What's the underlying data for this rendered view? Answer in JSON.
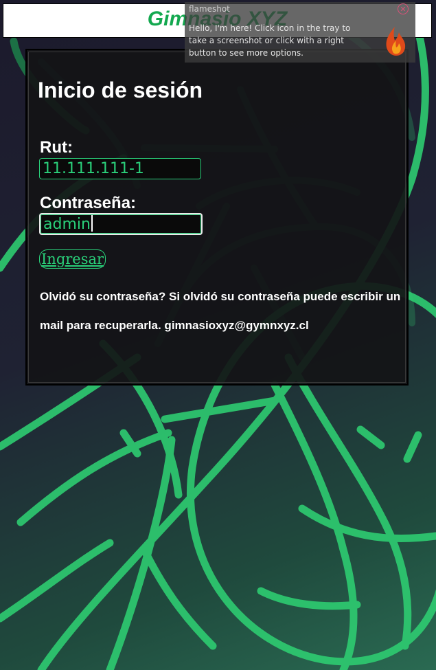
{
  "header": {
    "brand": "Gimnasio XYZ"
  },
  "login": {
    "title": "Inicio de sesión",
    "rut_label": "Rut:",
    "rut_value": "11.111.111-1",
    "password_label": "Contraseña:",
    "password_value": "admin",
    "submit_label": "Ingresar",
    "help_text": "Olvidó su contraseña? Si olvidó su contraseña puede escribir un mail para recuperarla. gimnasioxyz@gymnxyz.cl"
  },
  "notification": {
    "app": "flameshot",
    "message": "Hello, I'm here! Click icon in the tray to take a screenshot or click with a right button to see more options.",
    "icon": "flameshot-flame-icon"
  },
  "colors": {
    "accent": "#2ad07a",
    "brand": "#13a84f",
    "card_bg": "#141416",
    "close": "#d9537a"
  }
}
